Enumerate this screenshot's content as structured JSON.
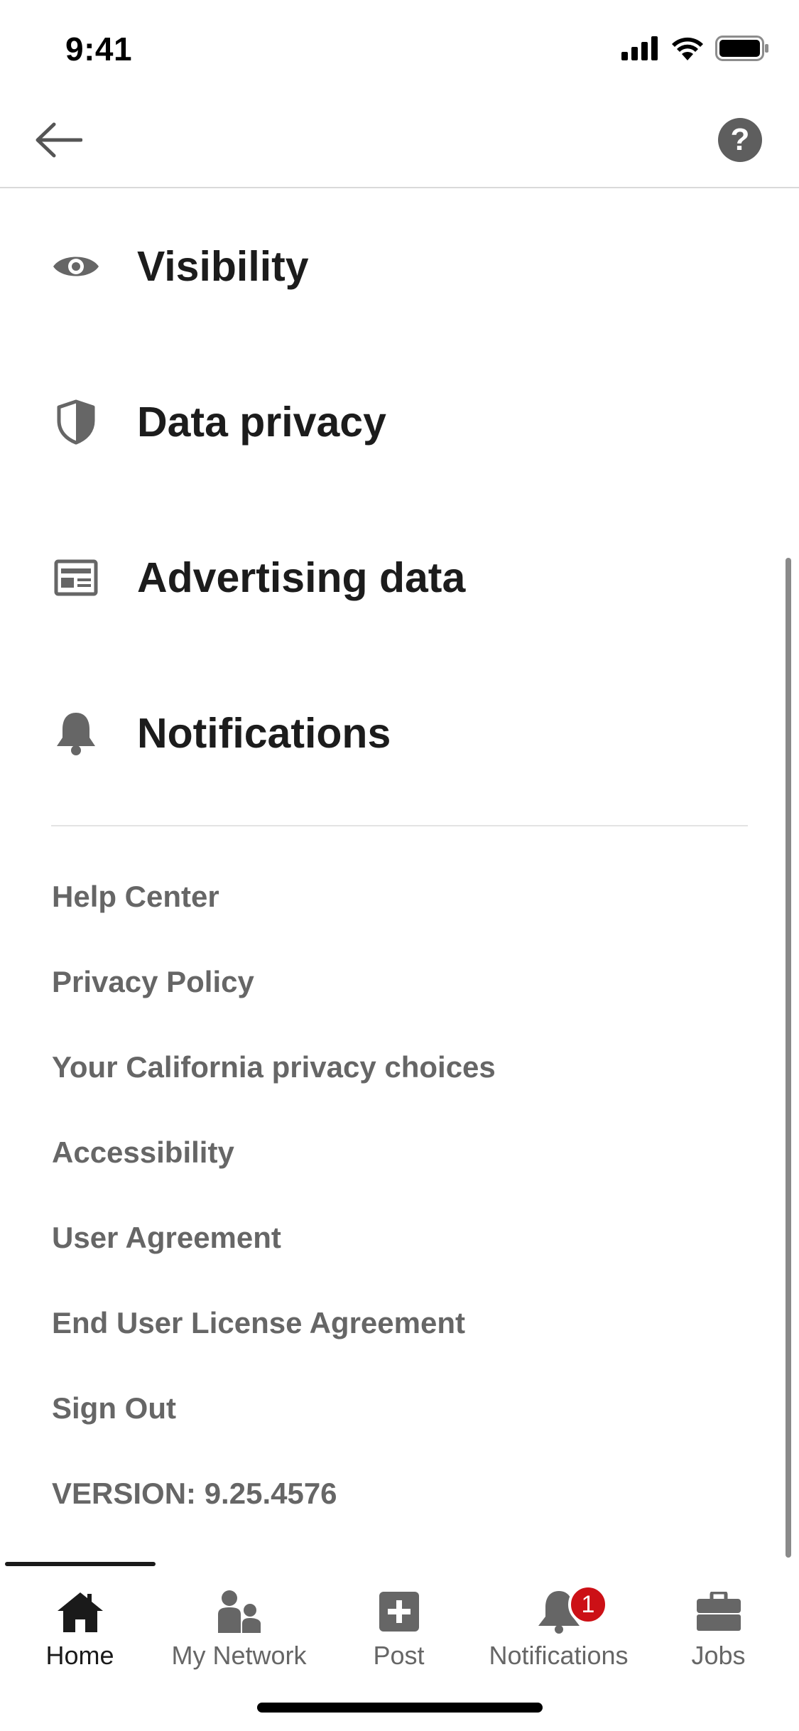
{
  "status_bar": {
    "time": "9:41"
  },
  "header": {
    "back_icon": "arrow-left-icon",
    "help_label": "?"
  },
  "main_items": [
    {
      "label": "Visibility",
      "icon": "eye-icon"
    },
    {
      "label": "Data privacy",
      "icon": "shield-icon"
    },
    {
      "label": "Advertising data",
      "icon": "ad-card-icon"
    },
    {
      "label": "Notifications",
      "icon": "bell-icon"
    }
  ],
  "links": [
    "Help Center",
    "Privacy Policy",
    "Your California privacy choices",
    "Accessibility",
    "User Agreement",
    "End User License Agreement",
    "Sign Out",
    "VERSION: 9.25.4576"
  ],
  "bottom_nav": {
    "items": [
      {
        "label": "Home",
        "icon": "home-icon",
        "active": true
      },
      {
        "label": "My Network",
        "icon": "people-icon",
        "active": false
      },
      {
        "label": "Post",
        "icon": "plus-square-icon",
        "active": false
      },
      {
        "label": "Notifications",
        "icon": "bell-icon",
        "active": false,
        "badge": "1"
      },
      {
        "label": "Jobs",
        "icon": "briefcase-icon",
        "active": false
      }
    ]
  },
  "colors": {
    "text_primary": "#1c1c1c",
    "text_secondary": "#666666",
    "icon_gray": "#5e5e5e",
    "badge_red": "#cc1016",
    "divider": "#e3e3e3"
  }
}
